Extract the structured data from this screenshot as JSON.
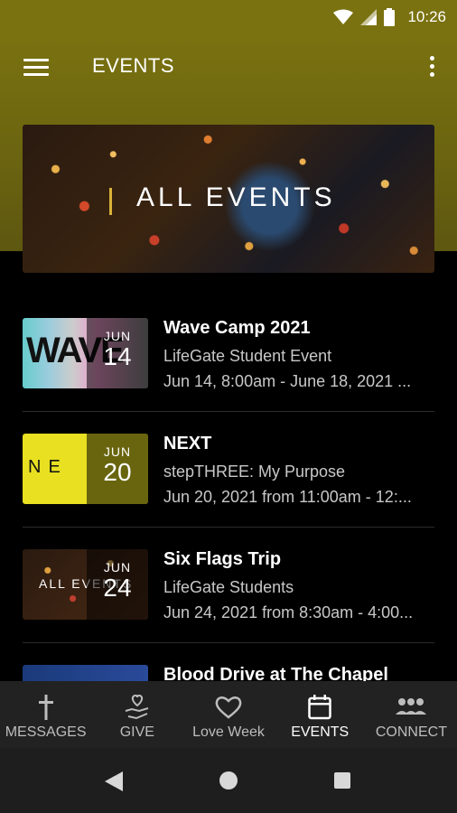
{
  "status_bar": {
    "time": "10:26",
    "icons": [
      "wifi-icon",
      "signal-icon",
      "battery-icon"
    ]
  },
  "app_bar": {
    "title": "EVENTS",
    "menu_icon": "hamburger-icon",
    "overflow_icon": "more-vert-icon"
  },
  "banner": {
    "text": "ALL EVENTS"
  },
  "events": [
    {
      "title": "Wave Camp 2021",
      "subtitle": "LifeGate Student Event",
      "date": "Jun 14, 8:00am - June 18, 2021 ...",
      "month": "JUN",
      "day": "14",
      "thumb_text": "WAVE"
    },
    {
      "title": "NEXT",
      "subtitle": "stepTHREE: My Purpose",
      "date": "Jun 20, 2021 from 11:00am - 12:...",
      "month": "JUN",
      "day": "20",
      "thumb_text": "NE"
    },
    {
      "title": "Six Flags Trip",
      "subtitle": "LifeGate Students",
      "date": "Jun 24, 2021 from 8:30am - 4:00...",
      "month": "JUN",
      "day": "24",
      "thumb_text": "ALL EVENTS"
    },
    {
      "title": "Blood Drive at The Chapel",
      "subtitle": "",
      "date": "",
      "month": "",
      "day": "",
      "thumb_text": ""
    }
  ],
  "bottom_nav": [
    {
      "label": "MESSAGES",
      "icon": "cross-icon",
      "active": false
    },
    {
      "label": "GIVE",
      "icon": "give-hand-heart-icon",
      "active": false
    },
    {
      "label": "Love Week",
      "icon": "heart-icon",
      "active": false
    },
    {
      "label": "EVENTS",
      "icon": "calendar-icon",
      "active": true
    },
    {
      "label": "CONNECT",
      "icon": "people-icon",
      "active": false
    }
  ],
  "colors": {
    "header": "#7a7210",
    "background": "#000000",
    "nav": "#222222",
    "accent": "#d9b23a"
  }
}
